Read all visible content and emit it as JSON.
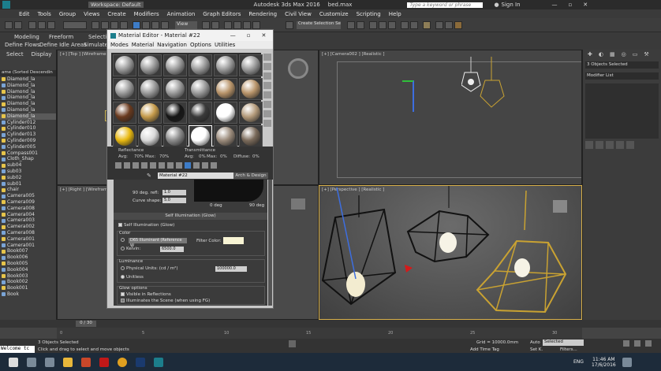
{
  "title_bar": {
    "app_title": "Autodesk 3ds Max 2016",
    "file_name": "bed.max",
    "workspace": "Workspace: Default",
    "search_placeholder": "Type a keyword or phrase",
    "sign_in": "Sign In"
  },
  "menu": [
    "Edit",
    "Tools",
    "Group",
    "Views",
    "Create",
    "Modifiers",
    "Animation",
    "Graph Editors",
    "Rendering",
    "Civil View",
    "Customize",
    "Scripting",
    "Help"
  ],
  "ribbon": {
    "tabs": [
      "Modeling",
      "Freeform",
      "Selection"
    ],
    "subtabs": [
      "Define Flows",
      "Define Idle Areas",
      "Simulate"
    ]
  },
  "toolbar": {
    "view_select": "View",
    "selection_set": "Create Selection Se"
  },
  "scene_explorer": {
    "tabs": [
      "Select",
      "Display"
    ],
    "header": "ame (Sorted Descendin",
    "items": [
      "Diamond_la",
      "Diamond_la",
      "Diamond_la",
      "Diamond_la",
      "Diamond_la",
      "Diamond_la",
      "Diamond_la",
      "Cylinder012",
      "Cylinder010",
      "Cylinder013",
      "Cylinder009",
      "Cylinder005",
      "Compass001",
      "Cloth_Shap",
      "sub04",
      "sub03",
      "sub02",
      "sub01",
      "chair",
      "Camera005",
      "Camera009",
      "Camera008",
      "Camera004",
      "Camera003",
      "Camera002",
      "Camera008",
      "Camera001",
      "Camera001",
      "Book007",
      "Book006",
      "Book005",
      "Book004",
      "Book003",
      "Book002",
      "Book001",
      "Book"
    ]
  },
  "viewports": {
    "top": "[+] [Top ] [Wireframe ]",
    "camera": "[+] [Camera002 ] [Realistic ]",
    "right": "[+] [Right ] [Wireframe ]",
    "perspective": "[+] [Perspective ] [Realistic ]"
  },
  "command_panel": {
    "selected": "3 Objects Selected",
    "modifier_list": "Modifier List"
  },
  "material_editor": {
    "title": "Material Editor - Material #22",
    "menu": [
      "Modes",
      "Material",
      "Navigation",
      "Options",
      "Utilities"
    ],
    "reflectance_label": "Reflectance",
    "reflectance_avg": "Avg:",
    "reflectance_avg_value": "70%",
    "reflectance_max": "Max:",
    "reflectance_max_value": "70%",
    "transmittance_label": "Transmittance",
    "transmittance_avg": "Avg:",
    "transmittance_avg_value": "0%",
    "transmittance_max": "Max:",
    "transmittance_max_value": "0%",
    "diffuse": "Diffuse:",
    "diffuse_value": "0%",
    "material_name": "Material #22",
    "material_type": "Arch & Design",
    "refl_90_label": "90 deg. refl:",
    "refl_90_value": "1.0",
    "curve_shape_label": "Curve shape:",
    "curve_shape_value": "5.0",
    "deg0": "0 deg",
    "deg90": "90 deg",
    "rollout_self_illum": "Self Illumination (Glow)",
    "self_illum_check": "Self Illumination (Glow)",
    "color_group": "Color",
    "illuminant": "D65 Illuminant (Reference W",
    "filter_color": "Filter Color:",
    "kelvin": "Kelvin:",
    "kelvin_value": "6500.0",
    "luminance_group": "Luminance",
    "physical_units": "Physical Units: (cd / m²)",
    "physical_value": "100000.0",
    "unitless": "Unitless",
    "glow_options": "Glow options",
    "visible_reflections": "Visible in Reflections",
    "illuminates_scene": "Illuminates the Scene (when using FG)"
  },
  "timeline": {
    "frame": "0 / 30",
    "ticks": [
      "0",
      "5",
      "10",
      "15",
      "20",
      "25",
      "30"
    ]
  },
  "status": {
    "maxscript": "Welcome tc",
    "selected": "3 Objects Selected",
    "prompt": "Click and drag to select and move objects",
    "grid": "Grid = 10000.0mm",
    "add_time_tag": "Add Time Tag",
    "auto": "Auto",
    "selected_dropdown": "Selected",
    "set_k": "Set K.",
    "filters": "Filters..."
  },
  "taskbar": {
    "language": "ENG",
    "time": "11:46 AM",
    "date": "17/6/2016"
  },
  "colors": {
    "accent": "#3d7cc7",
    "lamp_gold": "#c9a232",
    "lamp_black": "#111111"
  }
}
